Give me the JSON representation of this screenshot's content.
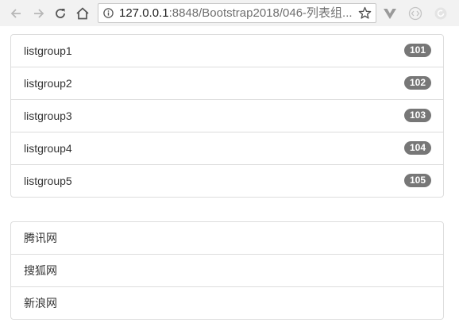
{
  "browser": {
    "url_host": "127.0.0.1",
    "url_path": ":8848/Bootstrap2018/046-列表组....",
    "icons": {
      "back": "arrow-left-icon",
      "forward": "arrow-right-icon",
      "reload": "reload-icon",
      "home": "home-icon",
      "info": "info-icon",
      "bookmark": "star-icon",
      "extensions": [
        "vue-devtools-icon",
        "code-extension-icon",
        "refresh-extension-icon"
      ]
    }
  },
  "list_group_badges": {
    "items": [
      {
        "label": "listgroup1",
        "badge": "101"
      },
      {
        "label": "listgroup2",
        "badge": "102"
      },
      {
        "label": "listgroup3",
        "badge": "103"
      },
      {
        "label": "listgroup4",
        "badge": "104"
      },
      {
        "label": "listgroup5",
        "badge": "105"
      }
    ]
  },
  "list_group_sites": {
    "items": [
      {
        "label": "腾讯网"
      },
      {
        "label": "搜狐网"
      },
      {
        "label": "新浪网"
      }
    ]
  },
  "colors": {
    "badge_bg": "#777777",
    "border": "#dddddd",
    "text": "#333333"
  }
}
